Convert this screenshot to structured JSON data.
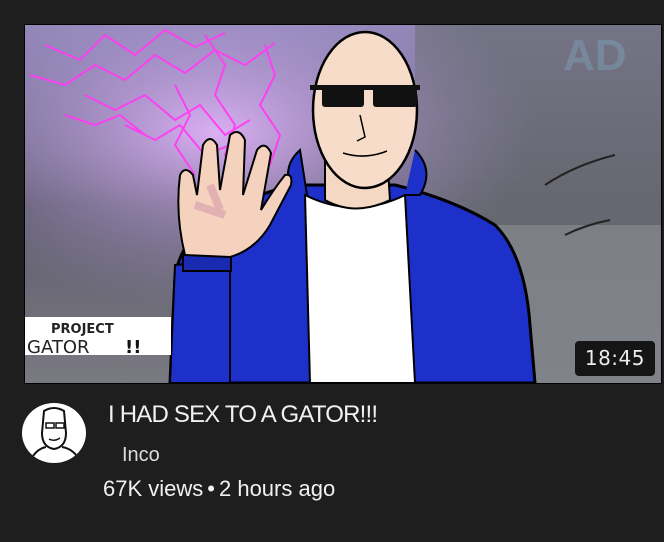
{
  "video": {
    "duration": "18:45",
    "title": "I HAD SEX TO A GATOR!!!",
    "channel": "Inco",
    "views": "67K views",
    "separator": "•",
    "age": "2 hours ago"
  },
  "thumbnail": {
    "logo_line1": "PROJECT",
    "logo_line2": "GATOR",
    "logo_suffix": "!!",
    "bg_text": "AD"
  },
  "colors": {
    "background": "#1e1e1e",
    "hoodie": "#1d30c9",
    "lightning": "#ff3df2",
    "text": "#f1f1f1"
  },
  "icons": [
    "avatar-sketch-icon"
  ]
}
